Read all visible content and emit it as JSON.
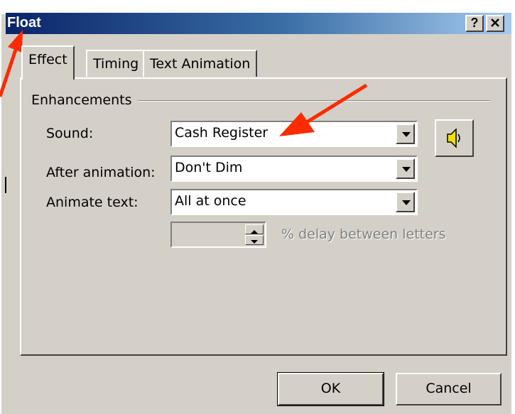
{
  "window": {
    "title": "Float",
    "help_label": "?",
    "close_label": "✕"
  },
  "tabs": [
    {
      "label": "Effect"
    },
    {
      "label": "Timing"
    },
    {
      "label": "Text Animation"
    }
  ],
  "enhancements": {
    "group_label": "Enhancements",
    "sound": {
      "label": "Sound:",
      "value": "Cash Register"
    },
    "after_animation": {
      "label": "After animation:",
      "value": "Don't Dim"
    },
    "animate_text": {
      "label": "Animate text:",
      "value": "All at once"
    },
    "delay": {
      "value": "",
      "label": "% delay between letters"
    }
  },
  "buttons": {
    "ok": "OK",
    "cancel": "Cancel"
  },
  "colors": {
    "annotation_arrow": "#ff2a00",
    "title_gradient_start": "#0a246a",
    "title_gradient_end": "#a6caf0"
  }
}
